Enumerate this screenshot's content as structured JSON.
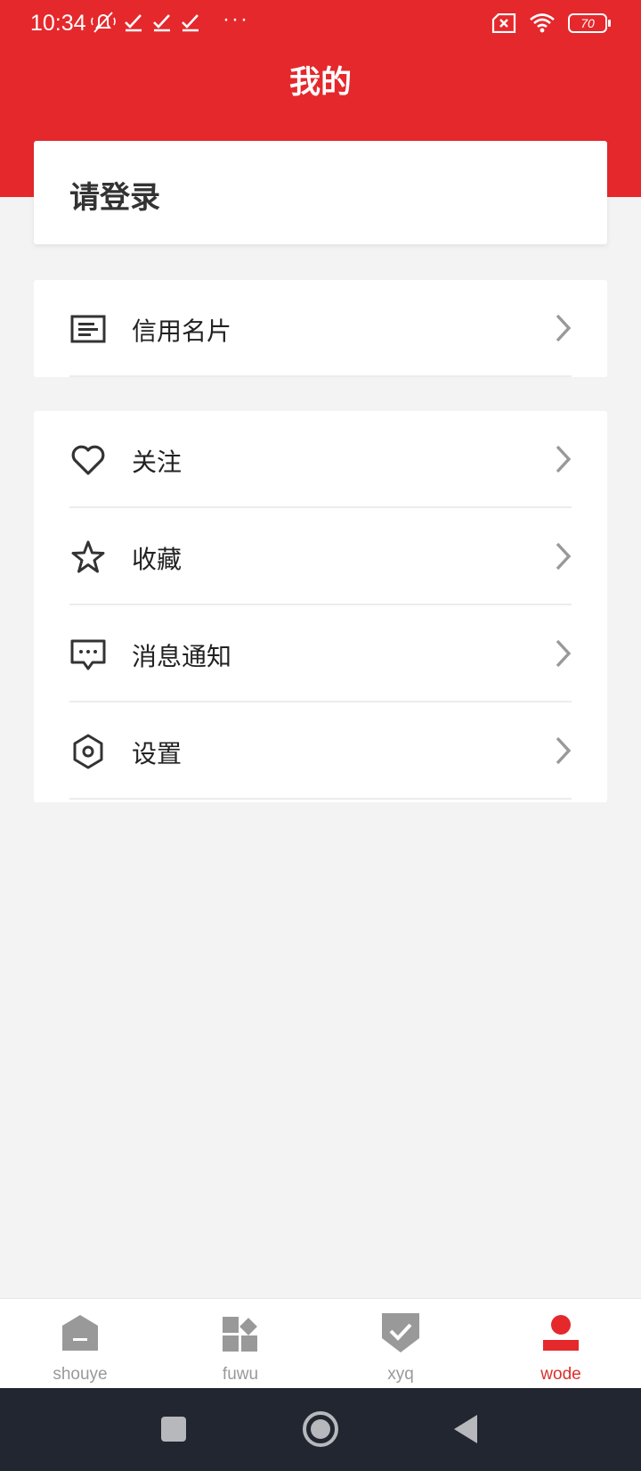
{
  "status_bar": {
    "time": "10:34",
    "dots": "···",
    "battery": "70"
  },
  "header": {
    "title": "我的"
  },
  "login": {
    "text": "请登录"
  },
  "menu_group_1": [
    {
      "label": "信用名片",
      "icon": "card-icon"
    }
  ],
  "menu_group_2": [
    {
      "label": "关注",
      "icon": "heart-icon"
    },
    {
      "label": "收藏",
      "icon": "star-icon"
    },
    {
      "label": "消息通知",
      "icon": "message-icon"
    },
    {
      "label": "设置",
      "icon": "settings-icon"
    }
  ],
  "bottom_nav": [
    {
      "label": "shouye",
      "icon": "home-icon",
      "active": false
    },
    {
      "label": "fuwu",
      "icon": "service-grid-icon",
      "active": false
    },
    {
      "label": "xyq",
      "icon": "shield-check-icon",
      "active": false
    },
    {
      "label": "wode",
      "icon": "person-icon",
      "active": true
    }
  ],
  "colors": {
    "accent": "#e5282c",
    "active_nav": "#d9302c",
    "inactive_nav": "#999999",
    "background": "#f3f3f3"
  }
}
